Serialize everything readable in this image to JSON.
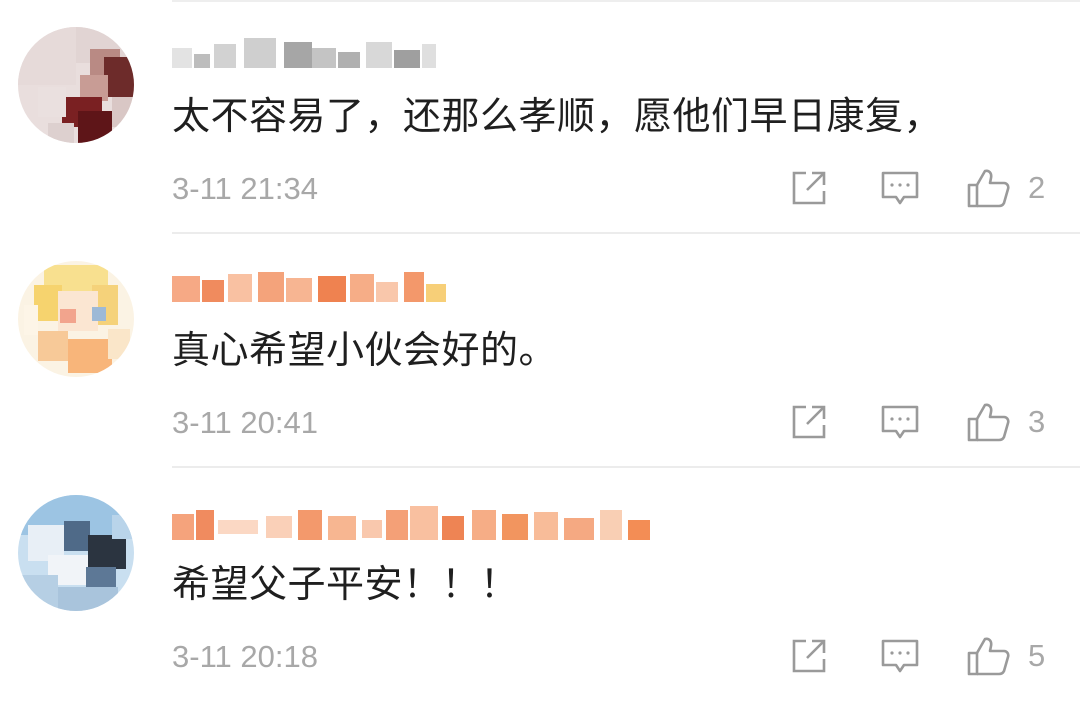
{
  "comments": [
    {
      "text": "太不容易了，还那么孝顺，愿他们早日康复，",
      "time": "3-11 21:34",
      "likes": "2",
      "avatar_icon": "user-avatar-pixelated",
      "username_colors": [
        "#dcdcdc",
        "#bdbdbd",
        "#c8c8c8",
        "#a9a9a9",
        "#d9d9d9",
        "#b5b5b5",
        "#cfcfcf",
        "#9e9e9e",
        "#e0e0e0",
        "#c0c0c0"
      ]
    },
    {
      "text": "真心希望小伙会好的。",
      "time": "3-11 20:41",
      "likes": "3",
      "avatar_icon": "user-avatar-pixelated",
      "username_colors": [
        "#f4a07a",
        "#f7b28f",
        "#f08b5e",
        "#f9c4a6",
        "#f29a6e",
        "#f6ad86",
        "#ee8150",
        "#f8bd9b",
        "#f3a378",
        "#f6b28c"
      ]
    },
    {
      "text": "希望父子平安！！！",
      "time": "3-11 20:18",
      "likes": "5",
      "avatar_icon": "user-avatar-pixelated",
      "username_colors": [
        "#f6a983",
        "#f9c6aa",
        "#f18e62",
        "#fad2bb",
        "#f4a077",
        "#f7b48f",
        "#ef8655",
        "#f9c2a3",
        "#f5a67f",
        "#f3996d"
      ]
    }
  ],
  "actions": {
    "share_icon": "share-icon",
    "reply_icon": "comment-icon",
    "like_icon": "thumbs-up-icon"
  },
  "colors": {
    "text": "#1f1f1f",
    "meta": "#a8a8a8",
    "divider": "#ececec"
  }
}
